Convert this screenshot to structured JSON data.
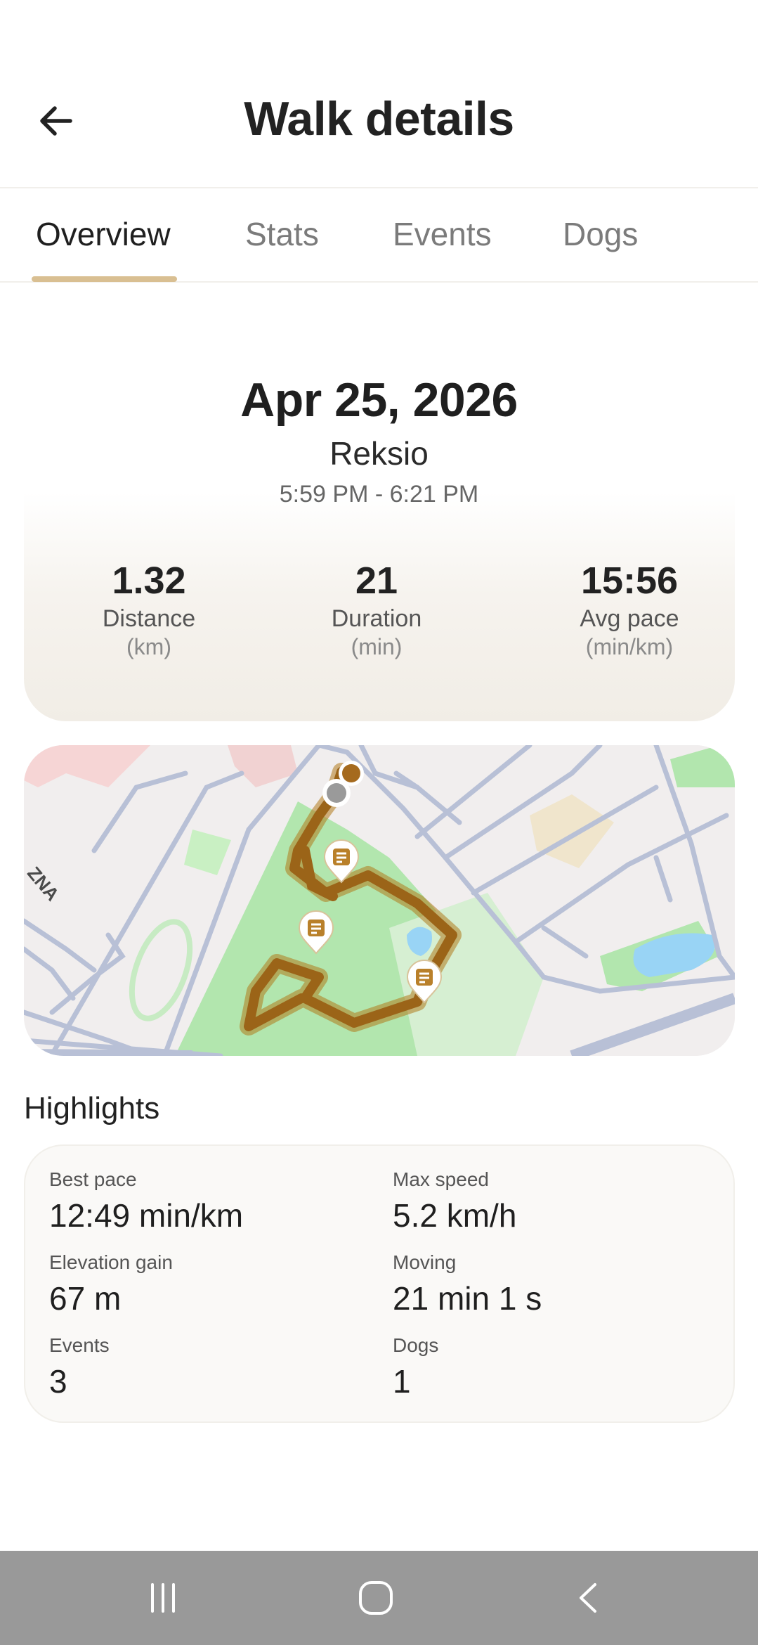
{
  "header": {
    "title": "Walk details"
  },
  "tabs": [
    {
      "label": "Overview",
      "active": true
    },
    {
      "label": "Stats",
      "active": false
    },
    {
      "label": "Events",
      "active": false
    },
    {
      "label": "Dogs",
      "active": false
    }
  ],
  "summary": {
    "date": "Apr 25, 2026",
    "dog_name": "Reksio",
    "time_range": "5:59 PM - 6:21 PM"
  },
  "stats": [
    {
      "value": "1.32",
      "label": "Distance",
      "unit": "(km)"
    },
    {
      "value": "21",
      "label": "Duration",
      "unit": "(min)"
    },
    {
      "value": "15:56",
      "label": "Avg pace",
      "unit": "(min/km)"
    }
  ],
  "map": {
    "street_label": "ZNA",
    "route_color": "#9b6418",
    "park_color": "#b2e6ae",
    "water_color": "#99d4f5",
    "event_markers": 3,
    "icons": [
      "note-icon",
      "start-point",
      "end-point"
    ]
  },
  "highlights": {
    "title": "Highlights",
    "items": [
      {
        "label": "Best pace",
        "value": "12:49 min/km"
      },
      {
        "label": "Max speed",
        "value": "5.2 km/h"
      },
      {
        "label": "Elevation gain",
        "value": "67 m"
      },
      {
        "label": "Moving",
        "value": "21 min 1 s"
      },
      {
        "label": "Events",
        "value": "3"
      },
      {
        "label": "Dogs",
        "value": "1"
      }
    ]
  },
  "system_nav": {
    "icons": [
      "recent-apps-icon",
      "home-icon",
      "back-nav-icon"
    ]
  },
  "colors": {
    "accent": "#d9bf92",
    "card_bg": "#f1ede6",
    "nav_bg": "#999999"
  }
}
